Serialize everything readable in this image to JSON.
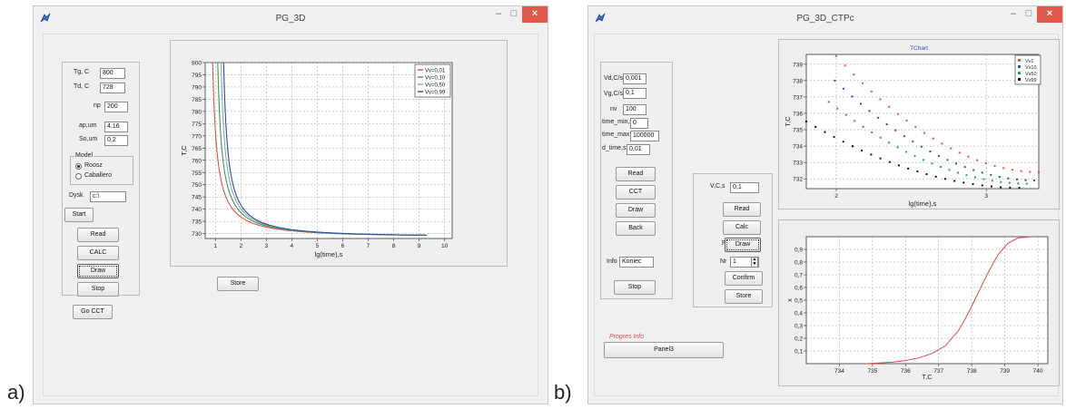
{
  "figure_labels": {
    "a": "a)",
    "b": "b)"
  },
  "window_a": {
    "title": "PG_3D",
    "controls": {
      "minimize": "–",
      "maximize": "□",
      "close": "×"
    },
    "params": {
      "tg_label": "Tg, C",
      "tg_value": "800",
      "td_label": "Td, C",
      "td_value": "728",
      "np_label": "np",
      "np_value": "200",
      "ap_label": "ap,um",
      "ap_value": "4,16",
      "so_label": "So,um",
      "so_value": "0,2"
    },
    "model": {
      "title": "Model",
      "options": [
        "Roosz",
        "Caballero"
      ],
      "selected": "Roosz"
    },
    "dysk": {
      "label": "Dysk",
      "value": "c:\\"
    },
    "buttons": {
      "start": "Start",
      "read": "Read",
      "calc": "CALC",
      "draw": "Draw",
      "stop": "Stop",
      "go_cct": "Go CCT",
      "store": "Store"
    }
  },
  "chart_data": [
    {
      "type": "line",
      "title": "",
      "xlabel": "lg(time),s",
      "ylabel": "T,C",
      "xlim": [
        0.6,
        10.3
      ],
      "ylim": [
        728,
        800
      ],
      "x_ticks": [
        1,
        2,
        3,
        4,
        5,
        6,
        7,
        8,
        9,
        10
      ],
      "y_ticks": [
        730,
        735,
        740,
        745,
        750,
        755,
        760,
        765,
        770,
        775,
        780,
        785,
        790,
        795,
        800
      ],
      "grid": true,
      "legend_position": "top-right",
      "series": [
        {
          "name": "Vv=0,01",
          "color": "#e05050",
          "asymptote_x": 0.72
        },
        {
          "name": "Vv=0,10",
          "color": "#2aa05a",
          "asymptote_x": 0.92
        },
        {
          "name": "Vv=0,50",
          "color": "#a0a0a0",
          "asymptote_x": 1.05
        },
        {
          "name": "Vv=0,99",
          "color": "#1f4fa0",
          "asymptote_x": 1.15
        }
      ]
    },
    {
      "type": "scatter",
      "title": "TChart",
      "xlabel": "lg(time),s",
      "ylabel": "T,C",
      "xlim": [
        1.8,
        3.35
      ],
      "ylim": [
        731.4,
        739.6
      ],
      "x_ticks": [
        2,
        3
      ],
      "y_ticks": [
        732,
        733,
        734,
        735,
        736,
        737,
        738,
        739
      ],
      "grid": true,
      "legend_position": "top-right",
      "series": [
        {
          "name": "Vv1",
          "color": "#e8504a",
          "x_start": 2.0,
          "y_start": 739.5,
          "x_end": 3.35,
          "y_end": 732.4
        },
        {
          "name": "Vv10",
          "color": "#2a55b0",
          "x_start": 1.99,
          "y_start": 738.0,
          "x_end": 3.32,
          "y_end": 731.9
        },
        {
          "name": "Vv50",
          "color": "#25a35a",
          "x_start": 1.95,
          "y_start": 736.7,
          "x_end": 3.27,
          "y_end": 731.7
        },
        {
          "name": "Vv99",
          "color": "#111111",
          "x_start": 1.8,
          "y_start": 735.5,
          "x_end": 3.22,
          "y_end": 731.45
        }
      ]
    },
    {
      "type": "line",
      "title": "",
      "xlabel": "T,C",
      "ylabel": "x",
      "xlim": [
        733,
        740.3
      ],
      "ylim": [
        0,
        1
      ],
      "x_ticks": [
        734,
        735,
        736,
        737,
        738,
        739,
        740
      ],
      "y_ticks": [
        0.1,
        0.2,
        0.3,
        0.4,
        0.5,
        0.6,
        0.7,
        0.8,
        0.9
      ],
      "y_tick_labels": [
        "0,1",
        "0,2",
        "0,3",
        "0,4",
        "0,5",
        "0,6",
        "0,7",
        "0,8",
        "0,9"
      ],
      "grid": true,
      "series": [
        {
          "name": "",
          "color": "#e04a4a",
          "x": [
            734.8,
            735.2,
            735.6,
            736.0,
            736.4,
            736.8,
            737.2,
            737.6,
            737.9,
            738.2,
            738.5,
            738.8,
            739.1,
            739.4,
            739.8
          ],
          "y": [
            0.0,
            0.005,
            0.012,
            0.025,
            0.045,
            0.08,
            0.14,
            0.26,
            0.4,
            0.56,
            0.72,
            0.86,
            0.95,
            0.99,
            1.0
          ]
        }
      ]
    }
  ],
  "window_b": {
    "title": "PG_3D_CTPc",
    "controls": {
      "minimize": "–",
      "maximize": "□",
      "close": "×"
    },
    "params": {
      "vd_label": "Vd,C/s",
      "vd_value": "0,001",
      "vg_label": "Vg,C/s",
      "vg_value": "0,1",
      "nv_label": "nv",
      "nv_value": "100",
      "tmin_label": "time_min,s",
      "tmin_value": "0",
      "tmax_label": "time_max,s",
      "tmax_value": "100000",
      "dtime_label": "d_time,s",
      "dtime_value": "0,01"
    },
    "buttons": {
      "read": "Read",
      "cct": "CCT",
      "draw": "Draw",
      "back": "Back",
      "stop": "Stop"
    },
    "info": {
      "label": "Info",
      "value": "Koniec"
    },
    "progres_info": "Progres Info",
    "panel3": "Panel3",
    "sub": {
      "v_label": "V,C,s",
      "v_value": "0,1",
      "read": "Read",
      "calc": "Calc",
      "f_label": "F",
      "draw": "Draw",
      "nr_label": "Nr",
      "nr_value": "1",
      "confirm": "Confirm",
      "store": "Store"
    }
  }
}
